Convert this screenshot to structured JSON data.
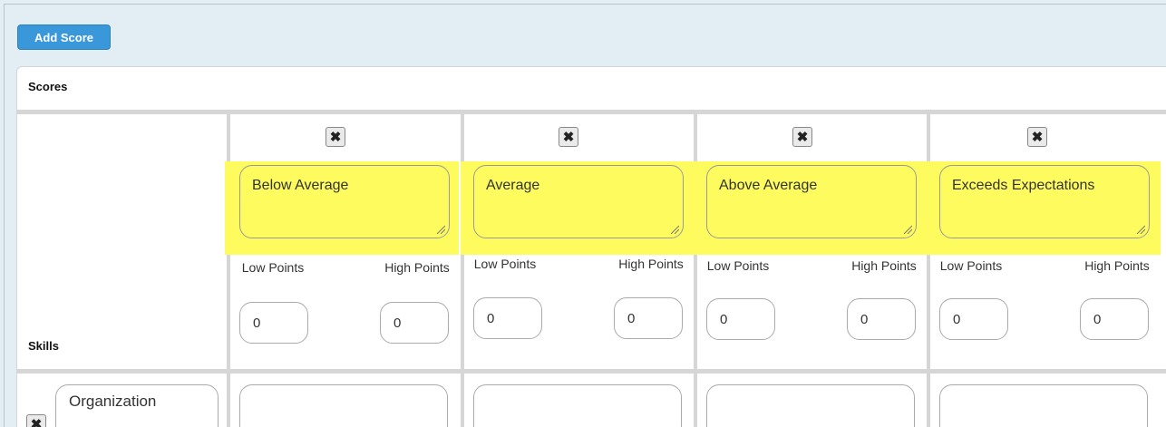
{
  "toolbar": {
    "add_score_label": "Add Score"
  },
  "section": {
    "title": "Scores",
    "skills_label": "Skills"
  },
  "colors": {
    "highlight": "#fefb5e",
    "button": "#3a97d9"
  },
  "icons": {
    "delete": "close-icon"
  },
  "score_columns": [
    {
      "name": "Below Average",
      "low_label": "Low Points",
      "high_label": "High Points",
      "low_value": "0",
      "high_value": "0"
    },
    {
      "name": "Average",
      "low_label": "Low Points",
      "high_label": "High Points",
      "low_value": "0",
      "high_value": "0"
    },
    {
      "name": "Above Average",
      "low_label": "Low Points",
      "high_label": "High Points",
      "low_value": "0",
      "high_value": "0"
    },
    {
      "name": "Exceeds Expectations",
      "low_label": "Low Points",
      "high_label": "High Points",
      "low_value": "0",
      "high_value": "0"
    }
  ],
  "skills": [
    {
      "name": "Organization"
    }
  ],
  "symbols": {
    "x": "✖"
  }
}
